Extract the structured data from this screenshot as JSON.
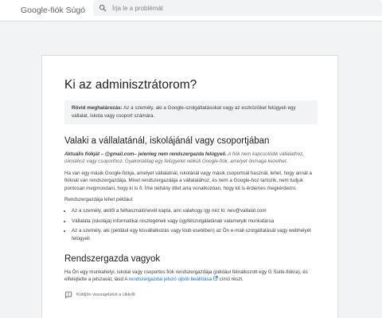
{
  "header": {
    "brand": "Google-fiók Súgó",
    "search_placeholder": "Írja le a problémát"
  },
  "article": {
    "title": "Ki az adminisztrátorom?",
    "summary_label": "Rövid meghatározás:",
    "summary_text": " Az a személy, aki a Google-szolgáltatásokat vagy az eszközöket felügyeli egy vállalat, iskola vagy csoport számára.",
    "section1": {
      "heading": "Valaki a vállalatánál, iskolájánál vagy csoportjában",
      "note_label": "Aktuális fiókját –        @gmail.com– jelenleg nem rendszergazda felügyeli.",
      "note_text": " A fiók nem kapcsolódik vállalathoz, iskolához vagy csoporthoz. Gyakorlatilag egy felügyelet nélküli Google-fiók, amelyet önmaga kezelhet.",
      "para1": "Ha van egy másik Google-fiókja, amelyet vállalatnál, iskolánál vagy másik csoportnál használ, lehet, hogy annál a fióknál van rendszergazdája. Mivel rendszergazdája a vállalatához, és nem a Google-hoz tartozik, nem tudjuk pontosan megmondani, hogy ki is ő. Íme néhány ötlet arra vonatkozóan, hogy kit is érdemes megkérdezni.",
      "list_intro": "Rendszergazdája lehet például:",
      "items": [
        "Az a személy, akitől a felhasználónevét kapta, ami valahogy így néz ki: nev@vallalat.com",
        "Vállalata (iskolája) informatikai részlegének vagy ügyfélszolgálatának valamelyik munkatársa",
        "Az a személy, aki (például egy kisvállalkozás vagy klub esetében) az Ön e-mail-szolgáltatását vagy webhelyét felügyeli"
      ]
    },
    "section2": {
      "heading": "Rendszergazda vagyok",
      "text_before": "Ha Ön egy munkahelyi, iskolai vagy csoportos fiók rendszergazdája (például feliratkozott egy G Suite-fiókra), és elfelejtette a jelszavát, lásd A ",
      "link": "rendszergazdai jelszó újbóli beállítása",
      "text_after": " című részt."
    },
    "feedback_label": "Küldjön visszajelzést a cikkről"
  }
}
